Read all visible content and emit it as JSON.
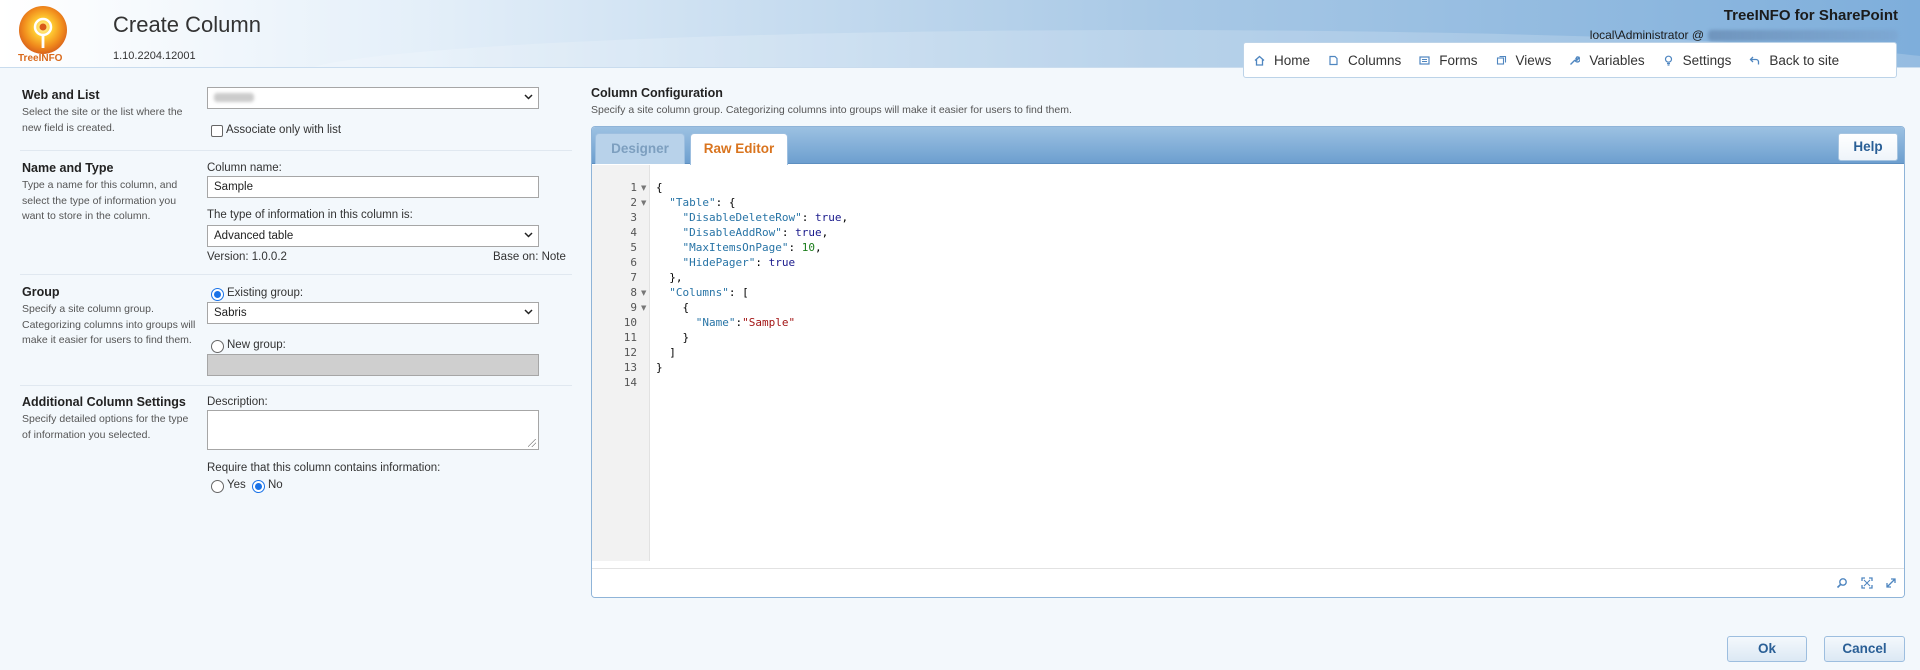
{
  "header": {
    "title": "Create Column",
    "version": "1.10.2204.12001",
    "logo_text": "TreeINFO",
    "brand": "TreeINFO for SharePoint",
    "user": "local\\Administrator @"
  },
  "nav": [
    {
      "label": "Home",
      "icon": "home-icon"
    },
    {
      "label": "Columns",
      "icon": "columns-icon"
    },
    {
      "label": "Forms",
      "icon": "forms-icon"
    },
    {
      "label": "Views",
      "icon": "views-icon"
    },
    {
      "label": "Variables",
      "icon": "wrench-icon"
    },
    {
      "label": "Settings",
      "icon": "lightbulb-icon"
    },
    {
      "label": "Back to site",
      "icon": "back-arrow-icon"
    }
  ],
  "web_and_list": {
    "title": "Web and List",
    "description": "Select the site or the list where the new field is created.",
    "associate_label": "Associate only with list"
  },
  "name_and_type": {
    "title": "Name and Type",
    "description": "Type a name for this column, and select the type of information you want to store in the column.",
    "column_name_label": "Column name:",
    "column_name_value": "Sample",
    "type_label": "The type of information in this column is:",
    "type_value": "Advanced table",
    "version": "Version: 1.0.0.2",
    "base_on": "Base on: Note"
  },
  "group": {
    "title": "Group",
    "description": "Specify a site column group. Categorizing columns into groups will make it easier for users to find them.",
    "existing_label": "Existing group:",
    "existing_value": "Sabris",
    "new_label": "New group:"
  },
  "additional": {
    "title": "Additional Column Settings",
    "description": "Specify detailed options for the type of information you selected.",
    "description_label": "Description:",
    "require_label": "Require that this column contains information:",
    "yes_label": "Yes",
    "no_label": "No",
    "require_selected": "No"
  },
  "config": {
    "title": "Column Configuration",
    "description": "Specify a site column group. Categorizing columns into groups will make it easier for users to find them.",
    "tabs": [
      "Designer",
      "Raw Editor"
    ],
    "active_tab": "Raw Editor",
    "help_label": "Help"
  },
  "editor": {
    "line_numbers": [
      "1",
      "2",
      "3",
      "4",
      "5",
      "6",
      "7",
      "8",
      "9",
      "10",
      "11",
      "12",
      "13",
      "14"
    ],
    "fold_lines": [
      "1",
      "2",
      "8",
      "9"
    ],
    "lines": [
      [
        {
          "t": "p",
          "v": "{"
        }
      ],
      [
        {
          "t": "p",
          "v": "  "
        },
        {
          "t": "key",
          "v": "\"Table\""
        },
        {
          "t": "p",
          "v": ": {"
        }
      ],
      [
        {
          "t": "p",
          "v": "    "
        },
        {
          "t": "key",
          "v": "\"DisableDeleteRow\""
        },
        {
          "t": "p",
          "v": ": "
        },
        {
          "t": "kw",
          "v": "true"
        },
        {
          "t": "p",
          "v": ","
        }
      ],
      [
        {
          "t": "p",
          "v": "    "
        },
        {
          "t": "key",
          "v": "\"DisableAddRow\""
        },
        {
          "t": "p",
          "v": ": "
        },
        {
          "t": "kw",
          "v": "true"
        },
        {
          "t": "p",
          "v": ","
        }
      ],
      [
        {
          "t": "p",
          "v": "    "
        },
        {
          "t": "key",
          "v": "\"MaxItemsOnPage\""
        },
        {
          "t": "p",
          "v": ": "
        },
        {
          "t": "num",
          "v": "10"
        },
        {
          "t": "p",
          "v": ","
        }
      ],
      [
        {
          "t": "p",
          "v": "    "
        },
        {
          "t": "key",
          "v": "\"HidePager\""
        },
        {
          "t": "p",
          "v": ": "
        },
        {
          "t": "kw",
          "v": "true"
        }
      ],
      [
        {
          "t": "p",
          "v": "  },"
        }
      ],
      [
        {
          "t": "p",
          "v": "  "
        },
        {
          "t": "key",
          "v": "\"Columns\""
        },
        {
          "t": "p",
          "v": ": ["
        }
      ],
      [
        {
          "t": "p",
          "v": "    {"
        }
      ],
      [
        {
          "t": "p",
          "v": "      "
        },
        {
          "t": "key",
          "v": "\"Name\""
        },
        {
          "t": "p",
          "v": ":"
        },
        {
          "t": "str",
          "v": "\"Sample\""
        }
      ],
      [
        {
          "t": "p",
          "v": "    }"
        }
      ],
      [
        {
          "t": "p",
          "v": "  ]"
        }
      ],
      [
        {
          "t": "p",
          "v": "}"
        }
      ],
      [
        {
          "t": "p",
          "v": ""
        }
      ]
    ],
    "footer_icons": [
      "search-icon",
      "fullscreen-icon",
      "expand-icon"
    ]
  },
  "buttons": {
    "ok": "Ok",
    "cancel": "Cancel"
  },
  "colors": {
    "accent": "#2a5f96",
    "active_tab": "#d9741e",
    "radio": "#1a73e8"
  }
}
